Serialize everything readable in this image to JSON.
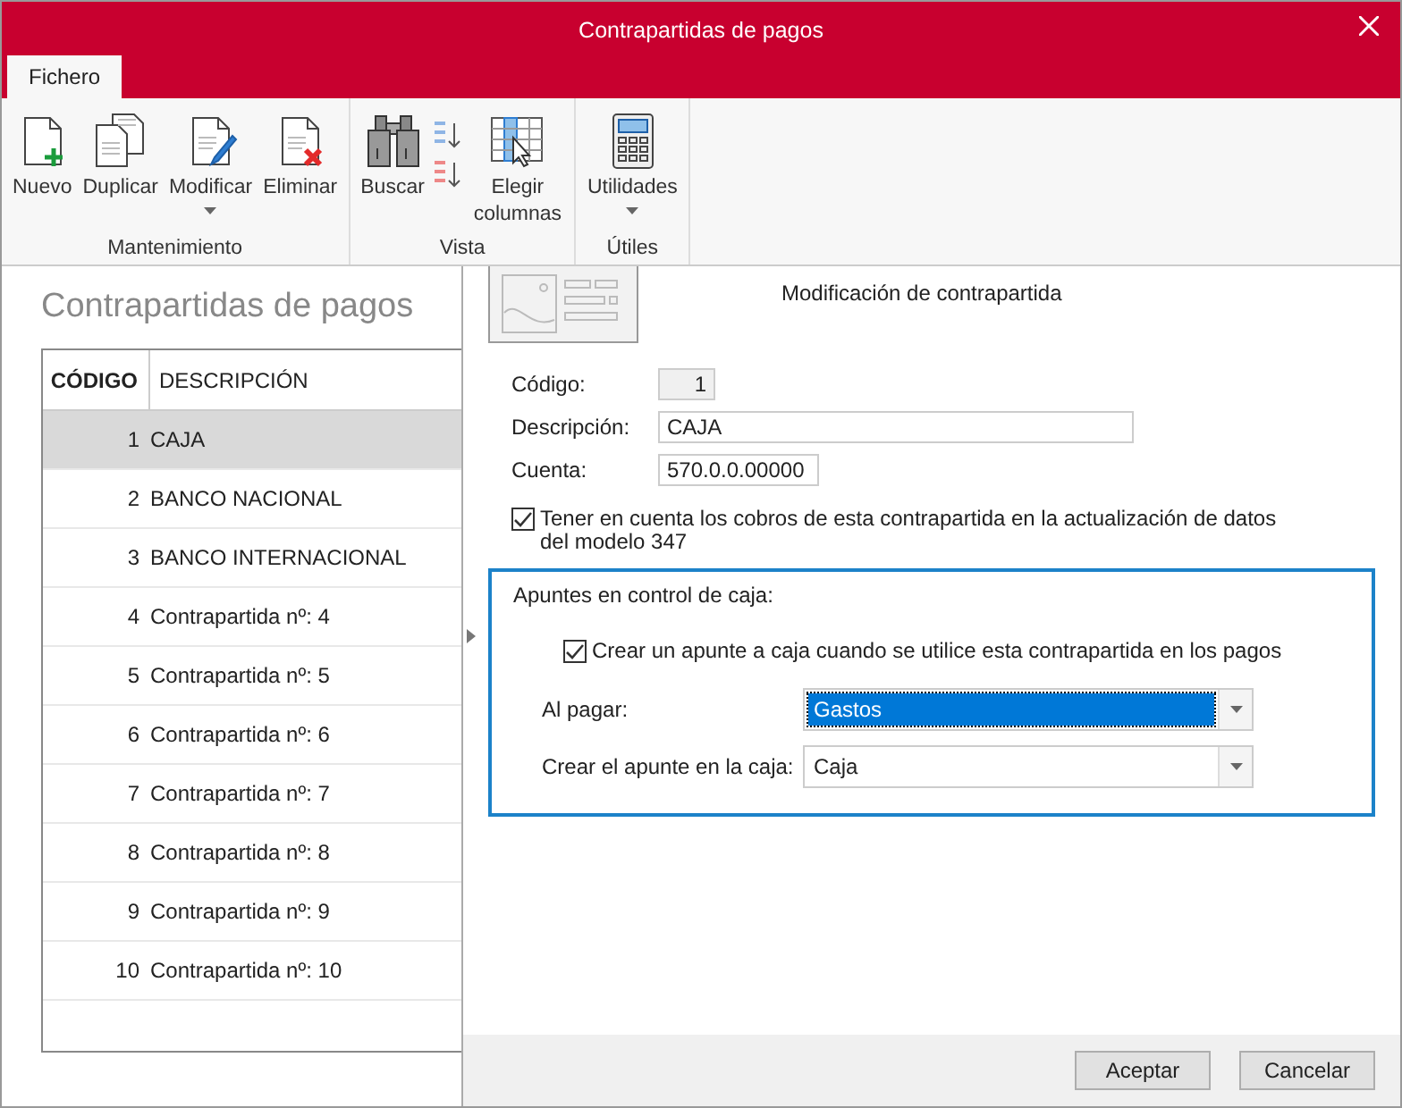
{
  "window": {
    "title": "Contrapartidas de pagos"
  },
  "ribbon": {
    "tabs": [
      {
        "label": "Fichero",
        "selected": true
      }
    ],
    "groups": [
      {
        "label": "Mantenimiento",
        "buttons": [
          {
            "kind": "new",
            "label": "Nuevo"
          },
          {
            "kind": "duplicate",
            "label": "Duplicar"
          },
          {
            "kind": "edit",
            "label": "Modificar",
            "dropdown": true
          },
          {
            "kind": "delete",
            "label": "Eliminar"
          }
        ]
      },
      {
        "label": "Vista",
        "buttons": [
          {
            "kind": "search",
            "label": "Buscar"
          },
          {
            "kind": "sort"
          },
          {
            "kind": "columns",
            "label": "Elegir columnas"
          }
        ]
      },
      {
        "label": "Útiles",
        "buttons": [
          {
            "kind": "calculator",
            "label": "Utilidades",
            "dropdown": true
          }
        ]
      }
    ]
  },
  "list": {
    "title": "Contrapartidas de pagos",
    "columns": [
      "CÓDIGO",
      "DESCRIPCIÓN"
    ],
    "rows": [
      {
        "code": "1",
        "description": "CAJA",
        "selected": true
      },
      {
        "code": "2",
        "description": "BANCO NACIONAL",
        "selected": false
      },
      {
        "code": "3",
        "description": "BANCO INTERNACIONAL",
        "selected": false
      },
      {
        "code": "4",
        "description": "Contrapartida nº: 4",
        "selected": false
      },
      {
        "code": "5",
        "description": "Contrapartida nº: 5",
        "selected": false
      },
      {
        "code": "6",
        "description": "Contrapartida nº: 6",
        "selected": false
      },
      {
        "code": "7",
        "description": "Contrapartida nº: 7",
        "selected": false
      },
      {
        "code": "8",
        "description": "Contrapartida nº: 8",
        "selected": false
      },
      {
        "code": "9",
        "description": "Contrapartida nº: 9",
        "selected": false
      },
      {
        "code": "10",
        "description": "Contrapartida nº: 10",
        "selected": false
      }
    ]
  },
  "form": {
    "title": "Modificación de contrapartida",
    "fields": [
      {
        "label": "Código:",
        "value": "1",
        "disabled": true
      },
      {
        "label": "Descripción:",
        "value": "CAJA",
        "disabled": false
      },
      {
        "label": "Cuenta:",
        "value": "570.0.0.00000",
        "disabled": false
      }
    ],
    "checkbox": {
      "label": "Tener en cuenta los cobros de esta contrapartida en la actualización de datos del modelo 347",
      "checked": true
    },
    "group": {
      "title": "Apuntes en control de caja:",
      "checkbox": {
        "label": "Crear un apunte a caja cuando se utilice esta contrapartida en los pagos",
        "checked": true
      },
      "selects": [
        {
          "label": "Al pagar:",
          "value": "Gastos",
          "focused": true
        },
        {
          "label": "Crear el apunte en la caja:",
          "value": "Caja",
          "focused": false
        }
      ]
    },
    "buttons": [
      "Aceptar",
      "Cancelar"
    ]
  }
}
